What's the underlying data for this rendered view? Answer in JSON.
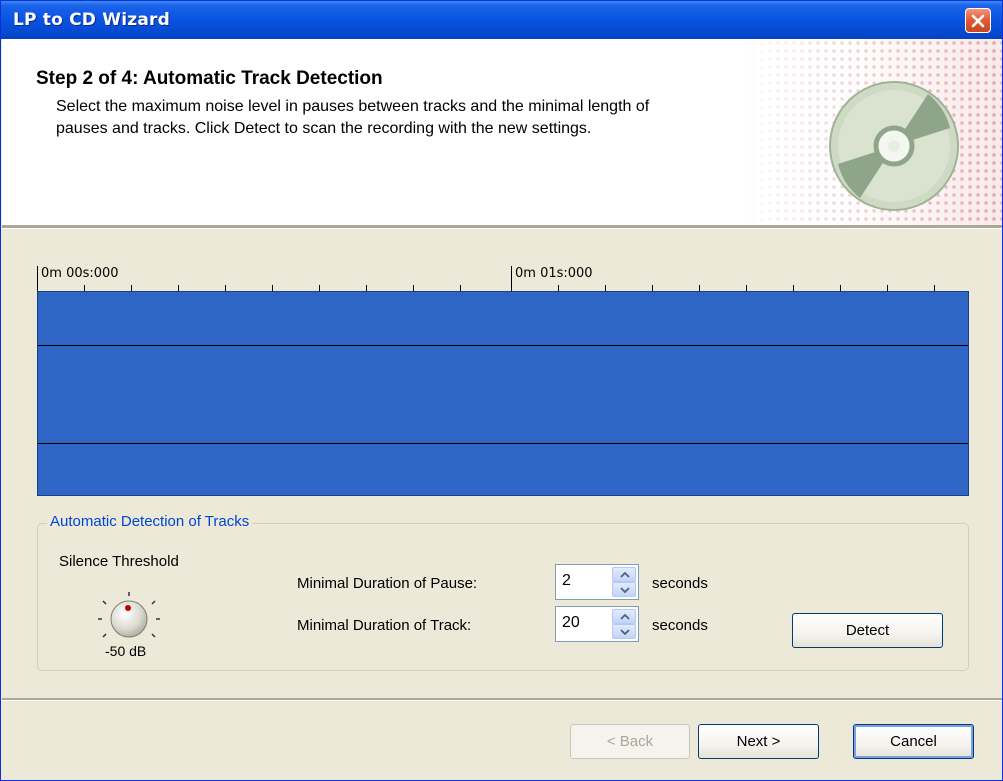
{
  "window": {
    "title": "LP to CD Wizard",
    "close_icon": "close-icon"
  },
  "header": {
    "step_title": "Step 2 of 4: Automatic Track Detection",
    "description": "Select the maximum noise level in pauses between tracks and the minimal length of pauses and tracks. Click Detect to scan the recording with the new settings.",
    "icon": "cd-disc-icon"
  },
  "timeline": {
    "marks": [
      "0m 00s:000",
      "0m 01s:000"
    ]
  },
  "detection": {
    "group_label": "Automatic Detection of Tracks",
    "silence_label": "Silence Threshold",
    "silence_value": "-50 dB",
    "pause_label": "Minimal Duration of Pause:",
    "pause_value": "2",
    "pause_unit": "seconds",
    "track_label": "Minimal Duration of Track:",
    "track_value": "20",
    "track_unit": "seconds",
    "detect_label": "Detect"
  },
  "footer": {
    "back_label": "< Back",
    "next_label": "Next >",
    "cancel_label": "Cancel"
  },
  "colors": {
    "waveform": "#2F65C4",
    "titlebar": "#0A55E3",
    "group_label": "#0046D5"
  }
}
